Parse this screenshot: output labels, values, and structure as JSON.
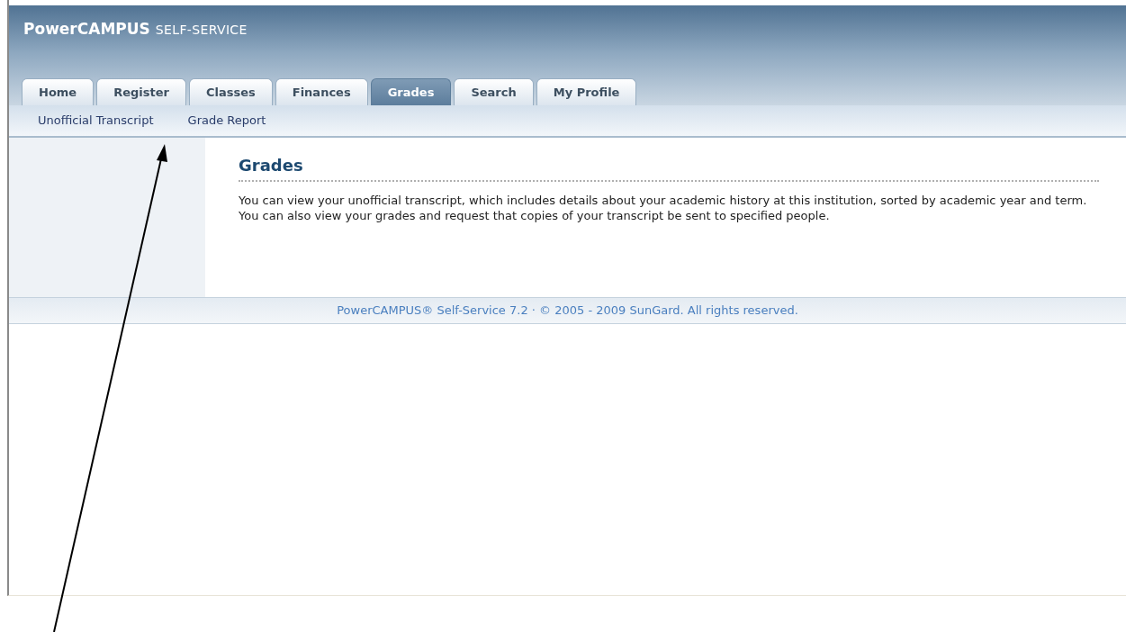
{
  "header": {
    "brand": "PowerCAMPUS",
    "brand_suffix": "SELF-SERVICE"
  },
  "tabs": [
    {
      "label": "Home",
      "selected": false
    },
    {
      "label": "Register",
      "selected": false
    },
    {
      "label": "Classes",
      "selected": false
    },
    {
      "label": "Finances",
      "selected": false
    },
    {
      "label": "Grades",
      "selected": true
    },
    {
      "label": "Search",
      "selected": false
    },
    {
      "label": "My Profile",
      "selected": false
    }
  ],
  "subnav": [
    "Unofficial Transcript",
    "Grade Report"
  ],
  "content": {
    "title": "Grades",
    "text": "You can view your unofficial transcript, which includes details about your academic history at this institution, sorted by academic year and term. You can also view your grades and request that copies of your transcript be sent to specified people."
  },
  "footer": "PowerCAMPUS® Self-Service 7.2 · © 2005 - 2009 SunGard. All rights reserved."
}
